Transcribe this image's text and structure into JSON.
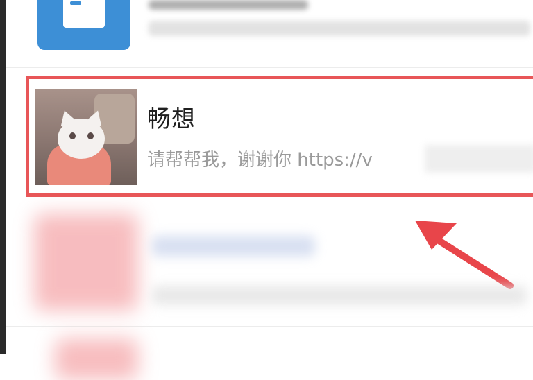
{
  "chat_list": {
    "highlighted_chat": {
      "name": "畅想",
      "preview": "请帮帮我，谢谢你 https://v"
    }
  },
  "colors": {
    "highlight_border": "#e85658",
    "arrow": "#e8454a",
    "doc_icon_bg": "#3d8fd6"
  },
  "icons": {
    "top_app_icon": "document-icon",
    "avatar": "cat-avatar",
    "annotation": "red-pointer-arrow"
  }
}
